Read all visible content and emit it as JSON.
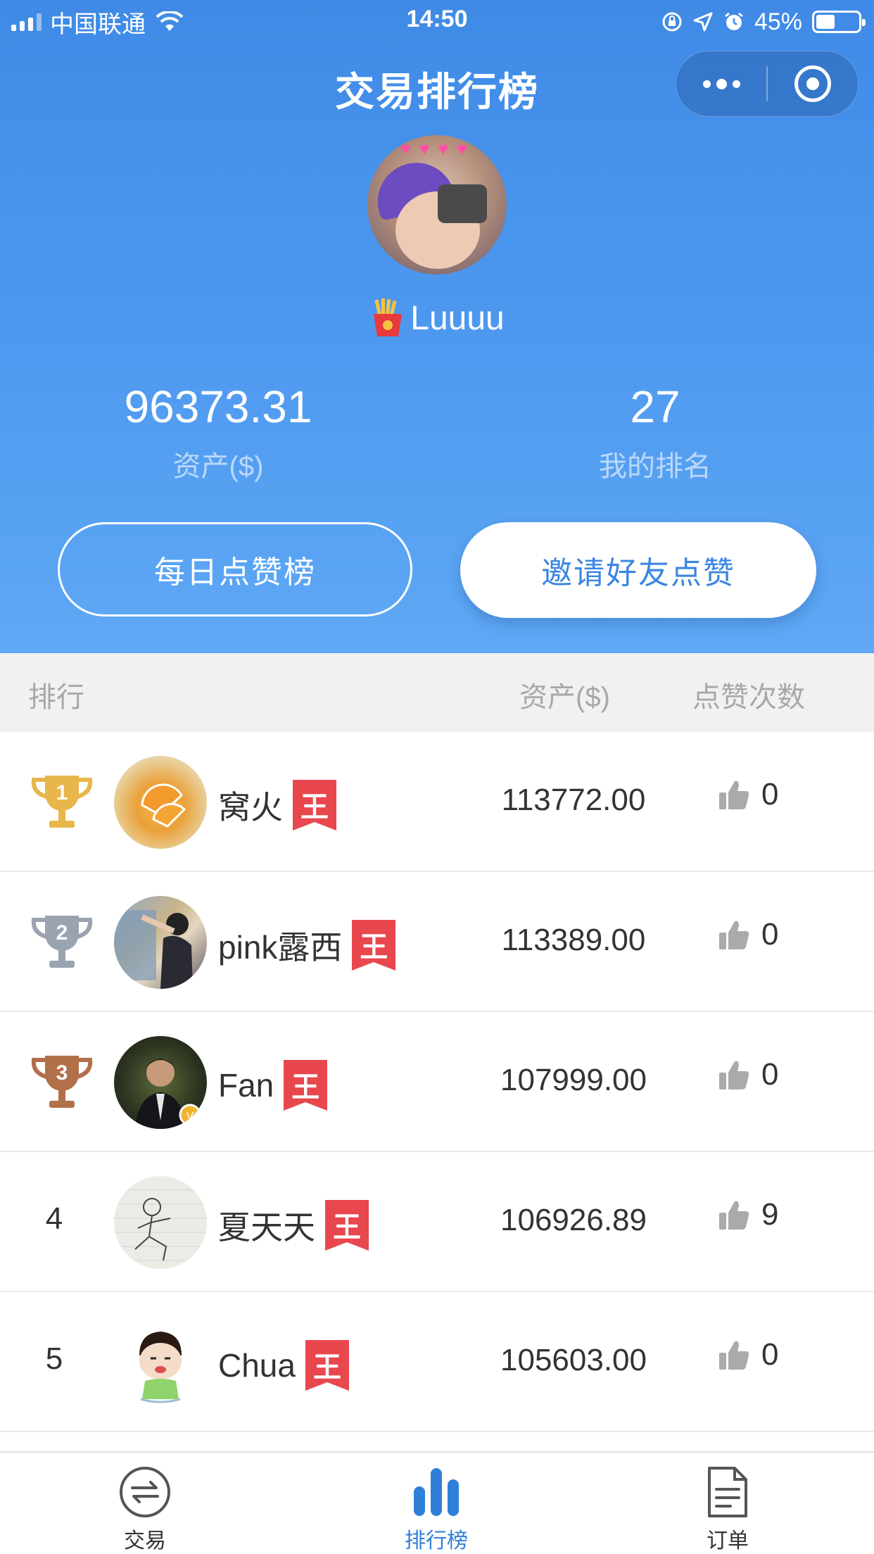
{
  "status_bar": {
    "carrier": "中国联通",
    "time": "14:50",
    "battery": "45%"
  },
  "nav": {
    "title": "交易排行榜"
  },
  "profile": {
    "username": "Luuuu",
    "assets_value": "96373.31",
    "assets_label": "资产($)",
    "rank_value": "27",
    "rank_label": "我的排名"
  },
  "buttons": {
    "daily_likes": "每日点赞榜",
    "invite": "邀请好友点赞"
  },
  "table": {
    "headers": {
      "rank": "排行",
      "assets": "资产($)",
      "likes": "点赞次数"
    },
    "badge": "王",
    "rows": [
      {
        "rank": "1",
        "name": "窝火",
        "assets": "113772.00",
        "likes": "0"
      },
      {
        "rank": "2",
        "name": "pink露西",
        "assets": "113389.00",
        "likes": "0"
      },
      {
        "rank": "3",
        "name": "Fan",
        "assets": "107999.00",
        "likes": "0"
      },
      {
        "rank": "4",
        "name": "夏天天",
        "assets": "106926.89",
        "likes": "9"
      },
      {
        "rank": "5",
        "name": "Chua",
        "assets": "105603.00",
        "likes": "0"
      }
    ]
  },
  "tabs": [
    {
      "label": "交易",
      "icon": "exchange-icon",
      "active": false
    },
    {
      "label": "排行榜",
      "icon": "bar-chart-icon",
      "active": true
    },
    {
      "label": "订单",
      "icon": "document-icon",
      "active": false
    }
  ],
  "colors": {
    "brand_blue": "#3f8ae6",
    "gold": "#e8b64a",
    "silver": "#9aa3b0",
    "bronze": "#b2704a",
    "badge_red": "#e8474e"
  }
}
